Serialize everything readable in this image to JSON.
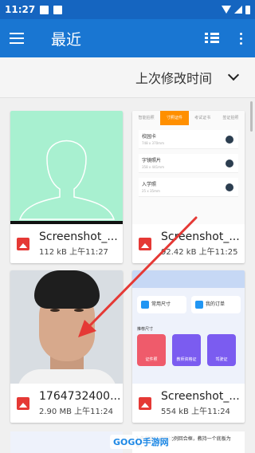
{
  "status_bar": {
    "time": "11:27"
  },
  "appbar": {
    "title": "最近"
  },
  "sort": {
    "label": "上次修改时间"
  },
  "files": [
    {
      "name": "Screenshot_...",
      "meta": "112 kB 上午11:27"
    },
    {
      "name": "Screenshot_...",
      "meta": "92.42 kB 上午11:25"
    },
    {
      "name": "1764732400...",
      "meta": "2.90 MB 上午11:24"
    },
    {
      "name": "Screenshot_...",
      "meta": "554 kB 上午11:24"
    }
  ],
  "thumb2": {
    "tabs": [
      "智能拍照",
      "寸照证件",
      "考试证书",
      "签证拍照"
    ],
    "rows": [
      {
        "title": "校园卡",
        "sub": "748 x 370mm"
      },
      {
        "title": "字镜照片",
        "sub": "358 x 441mm"
      },
      {
        "title": "入学照",
        "sub": "25 x 35mm"
      }
    ]
  },
  "thumb4": {
    "buttons": [
      "常用尺寸",
      "我的订单"
    ],
    "section": "推荐尺寸",
    "tiles": [
      "证件照",
      "教师资格证",
      "驾驶证"
    ]
  },
  "partial_text": "2.先截图了保留比例回合框，教持一个底板为多，…",
  "watermark": "GOGO手游网",
  "colors": {
    "status": "#1565c0",
    "appbar": "#1976d2",
    "file_icon": "#e53935",
    "arrow": "#e53935"
  }
}
